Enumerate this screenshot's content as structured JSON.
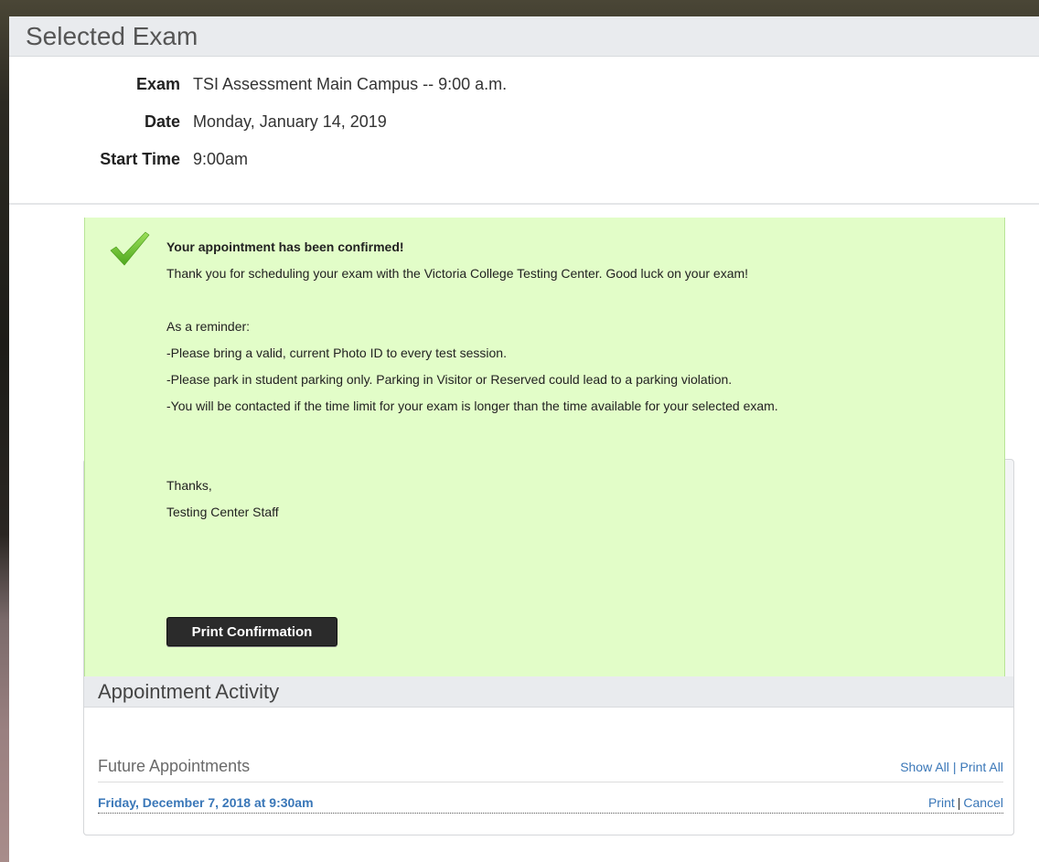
{
  "selected_exam": {
    "title": "Selected Exam",
    "details": [
      {
        "label": "Exam",
        "value": "TSI Assessment Main Campus -- 9:00 a.m."
      },
      {
        "label": "Date",
        "value": "Monday, January 14, 2019"
      },
      {
        "label": "Start Time",
        "value": "9:00am"
      }
    ]
  },
  "confirmation": {
    "icon": "checkmark-icon",
    "accent_color": "#e2fdc8",
    "title": "Your appointment has been confirmed!",
    "thanks_line": "Thank you for scheduling your exam with the Victoria College Testing Center.  Good luck on your exam!",
    "reminder_heading": "As a reminder:",
    "reminders": [
      "-Please bring a valid, current Photo ID to every test session.",
      "-Please park in student parking only. Parking in Visitor or Reserved could lead to a parking violation.",
      "-You will be contacted if the time limit for your exam is longer than the time available for your selected exam."
    ],
    "signoff": "Thanks,",
    "signature": "Testing Center Staff",
    "print_button": "Print Confirmation"
  },
  "activity": {
    "title": "Appointment Activity",
    "future_title": "Future Appointments",
    "show_all": "Show All",
    "print_all": "Print All",
    "separator": "|",
    "appointments": [
      {
        "when": "Friday, December 7, 2018 at 9:30am",
        "print": "Print",
        "cancel": "Cancel"
      }
    ]
  },
  "colors": {
    "link": "#3a77b8",
    "button": "#2b2b2b"
  }
}
